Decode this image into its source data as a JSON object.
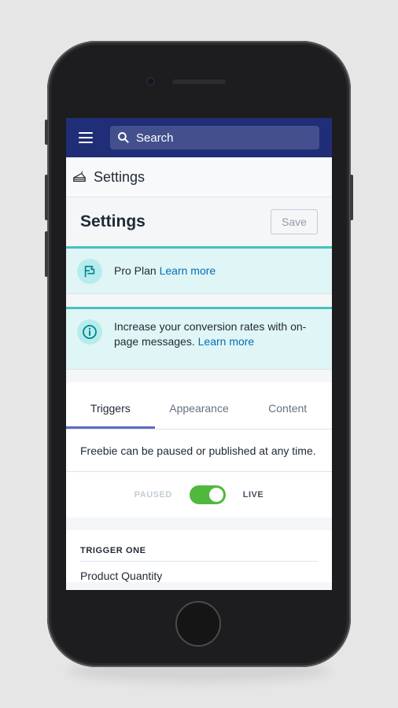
{
  "topbar": {
    "menu_icon": "hamburger-icon",
    "search": {
      "icon": "search-icon",
      "placeholder": "Search"
    }
  },
  "breadcrumb": {
    "icon": "cake-icon",
    "label": "Settings"
  },
  "page": {
    "title": "Settings",
    "save_label": "Save"
  },
  "banners": {
    "plan": {
      "icon": "flag-icon",
      "text": "Pro Plan",
      "link": "Learn more"
    },
    "info": {
      "icon": "info-icon",
      "text": "Increase your conversion rates with on-page messages.",
      "link": "Learn more"
    }
  },
  "tabs": [
    {
      "label": "Triggers",
      "active": true
    },
    {
      "label": "Appearance",
      "active": false
    },
    {
      "label": "Content",
      "active": false
    }
  ],
  "status": {
    "description": "Freebie can be paused or published at any time.",
    "paused_label": "PAUSED",
    "live_label": "LIVE",
    "is_live": true
  },
  "trigger": {
    "heading": "TRIGGER ONE",
    "field_label": "Product Quantity"
  },
  "colors": {
    "topbar": "#202e78",
    "accent": "#5c6ac4",
    "banner_bg": "#e0f5f5",
    "banner_border": "#47c1bf",
    "toggle_on": "#50b83c",
    "link": "#006fbb"
  }
}
